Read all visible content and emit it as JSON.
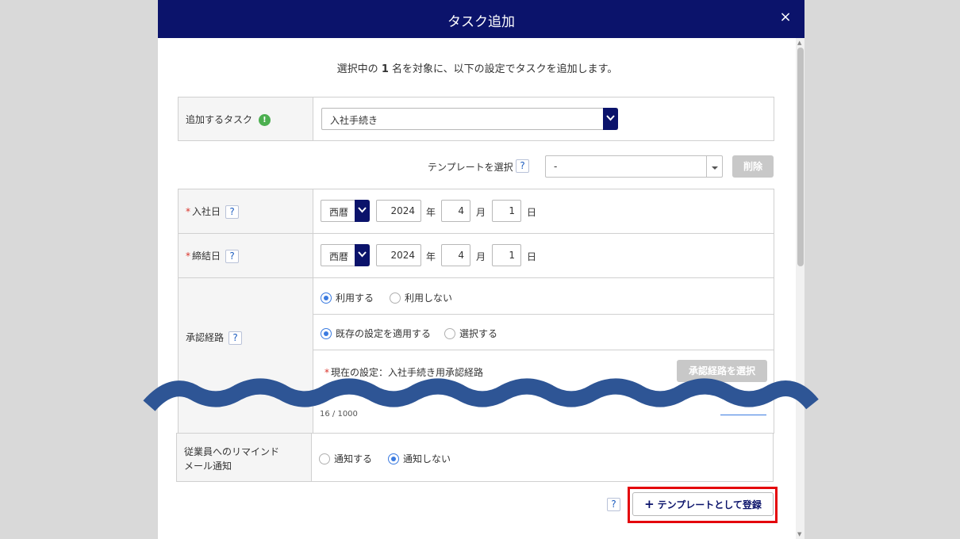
{
  "modal": {
    "title": "タスク追加",
    "close": "×"
  },
  "intro": {
    "before": "選択中の",
    "count": "1",
    "after": "名を対象に、以下の設定でタスクを追加します。"
  },
  "task": {
    "label": "追加するタスク",
    "info_icon": "!",
    "value": "入社手続き"
  },
  "template": {
    "label": "テンプレートを選択",
    "help": "?",
    "value": "-",
    "delete_label": "削除"
  },
  "join_date": {
    "required": "*",
    "label": "入社日",
    "help": "?",
    "era": "西暦",
    "year": "2024",
    "year_unit": "年",
    "month": "4",
    "month_unit": "月",
    "day": "1",
    "day_unit": "日"
  },
  "contract_date": {
    "required": "*",
    "label": "締結日",
    "help": "?",
    "era": "西暦",
    "year": "2024",
    "year_unit": "年",
    "month": "4",
    "month_unit": "月",
    "day": "1",
    "day_unit": "日"
  },
  "approval": {
    "label": "承認経路",
    "help": "?",
    "use_options": [
      "利用する",
      "利用しない"
    ],
    "mode_options": [
      "既存の設定を適用する",
      "選択する"
    ],
    "current_required": "*",
    "current": "現在の設定：入社手続き用承認経路",
    "select_button": "承認経路を選択"
  },
  "memo": {
    "counter": "16 / 1000"
  },
  "remind": {
    "label_line1": "従業員へのリマインド",
    "label_line2": "メール通知",
    "options": [
      "通知する",
      "通知しない"
    ]
  },
  "footer": {
    "help": "?",
    "plus": "+",
    "register_label": "テンプレートとして登録"
  },
  "colors": {
    "header": "#0b136b",
    "accent": "#3b7be0",
    "highlight": "#e4060c",
    "wave": "#2e5595"
  },
  "icons": [
    "close-icon",
    "info-icon",
    "chevron-down-icon",
    "help-icon",
    "plus-icon"
  ]
}
